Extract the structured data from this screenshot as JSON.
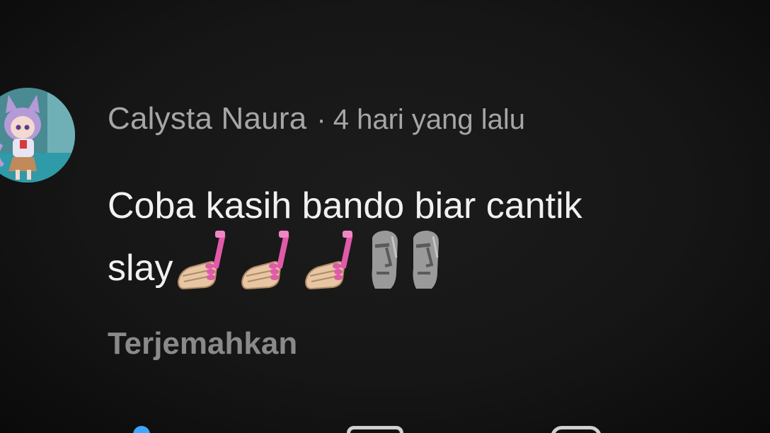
{
  "comment": {
    "author": "Calysta Naura",
    "separator": "·",
    "time": "4 hari yang lalu",
    "text_line1": "Coba kasih bando biar cantik",
    "text_line2": "slay",
    "emojis": [
      "nail-polish",
      "nail-polish",
      "nail-polish",
      "moai",
      "moai"
    ],
    "translate_label": "Terjemahkan"
  },
  "colors": {
    "background": "#161616",
    "author_text": "#a6a6a6",
    "body_text": "#f1f1f1",
    "translate_text": "#8a8a8a"
  }
}
